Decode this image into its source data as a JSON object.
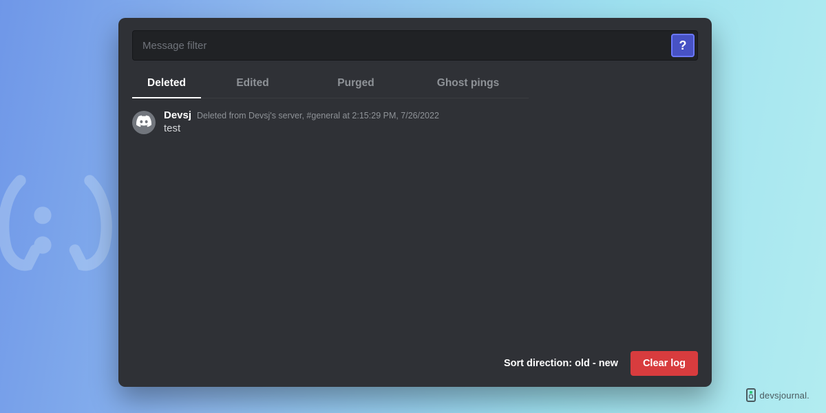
{
  "search": {
    "placeholder": "Message filter",
    "value": "",
    "help_label": "?"
  },
  "tabs": [
    {
      "label": "Deleted",
      "active": true
    },
    {
      "label": "Edited",
      "active": false
    },
    {
      "label": "Purged",
      "active": false
    },
    {
      "label": "Ghost pings",
      "active": false
    }
  ],
  "messages": [
    {
      "author": "Devsj",
      "meta": "Deleted from Devsj's server, #general at 2:15:29 PM, 7/26/2022",
      "content": "test",
      "avatar_icon": "discord-icon"
    }
  ],
  "footer": {
    "sort_label": "Sort direction: old - new",
    "clear_label": "Clear log"
  },
  "brand": {
    "text": "devsjournal."
  },
  "colors": {
    "panel_bg": "#2f3136",
    "input_bg": "#202225",
    "accent": "#4752c4",
    "danger": "#d83c3e"
  }
}
